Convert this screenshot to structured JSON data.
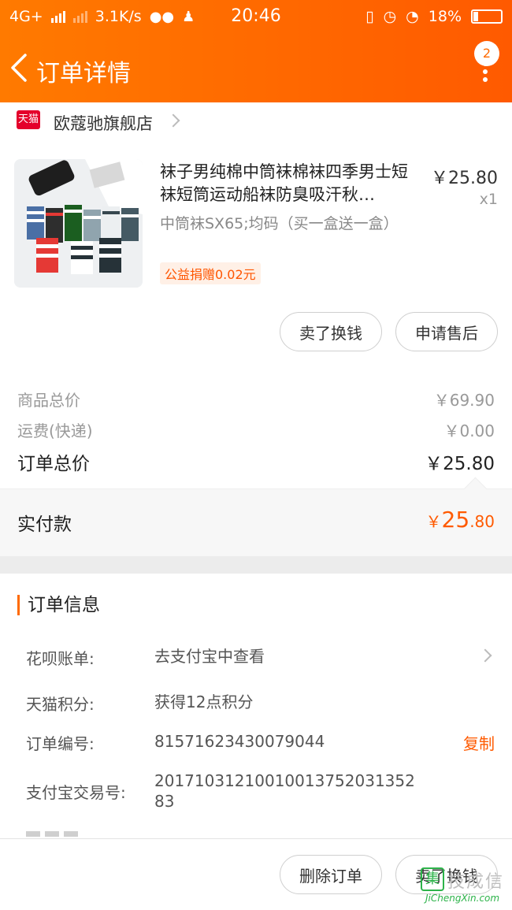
{
  "status_bar": {
    "network": "4G+",
    "speed": "3.1K/s",
    "time": "20:46",
    "battery": "18%"
  },
  "header": {
    "title": "订单详情",
    "badge_count": "2"
  },
  "shop": {
    "badge_text": "天猫",
    "name": "欧蔻驰旗舰店"
  },
  "product": {
    "title": "袜子男纯棉中筒袜棉袜四季男士短袜短筒运动船袜防臭吸汗秋…",
    "sku": "中筒袜SX65;均码（买一盒送一盒）",
    "charity": "公益捐赠0.02元",
    "price": "￥25.80",
    "qty": "x1",
    "buttons": [
      "卖了换钱",
      "申请售后"
    ]
  },
  "summary": {
    "goods_label": "商品总价",
    "goods_value": "￥69.90",
    "shipping_label": "运费(快递)",
    "shipping_value": "￥0.00",
    "total_label": "订单总价",
    "total_value": "￥25.80",
    "paid_label": "实付款",
    "paid_currency": "￥",
    "paid_int": "25",
    "paid_dec": ".80"
  },
  "order_info": {
    "heading": "订单信息",
    "rows": [
      {
        "label": "花呗账单:",
        "value": "去支付宝中查看"
      },
      {
        "label": "天猫积分:",
        "value": "获得12点积分"
      },
      {
        "label": "订单编号:",
        "value": "81571623430079044",
        "action": "复制"
      },
      {
        "label": "支付宝交易号:",
        "value": "2017103121001001375203135283"
      }
    ]
  },
  "bottom_bar": {
    "buttons": [
      "删除订单",
      "卖了换钱"
    ]
  },
  "watermark": {
    "cn": "技成信",
    "en": "JiChengXin.com"
  },
  "colors": {
    "accent": "#ff6a00",
    "price": "#ff5a00"
  }
}
